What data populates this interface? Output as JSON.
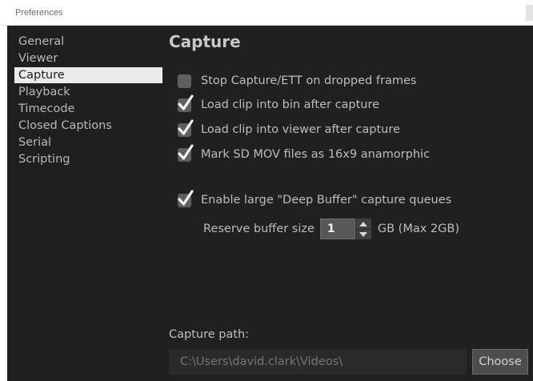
{
  "window": {
    "title": "Preferences"
  },
  "sidebar": {
    "items": [
      {
        "label": "General"
      },
      {
        "label": "Viewer"
      },
      {
        "label": "Capture"
      },
      {
        "label": "Playback"
      },
      {
        "label": "Timecode"
      },
      {
        "label": "Closed Captions"
      },
      {
        "label": "Serial"
      },
      {
        "label": "Scripting"
      }
    ],
    "selected": "Capture"
  },
  "capture": {
    "title": "Capture",
    "options": [
      {
        "label": "Stop Capture/ETT on dropped frames",
        "checked": false
      },
      {
        "label": "Load clip into bin after capture",
        "checked": true
      },
      {
        "label": "Load clip into viewer after capture",
        "checked": true
      },
      {
        "label": "Mark SD MOV files as 16x9 anamorphic",
        "checked": true
      },
      {
        "label": "Enable large \"Deep Buffer\" capture queues",
        "checked": true
      }
    ],
    "reserve": {
      "label": "Reserve buffer size",
      "value": "1",
      "suffix": "GB (Max 2GB)"
    },
    "path": {
      "label": "Capture path:",
      "value": "C:\\Users\\david.clark\\Videos\\",
      "choose_label": "Choose"
    }
  },
  "colors": {
    "background": "#1f1f1f",
    "selected_item": "#ebebeb",
    "text": "#bdbdbd",
    "checkbox": "#5f5f5f",
    "checkmark": "#f0f0f0"
  }
}
